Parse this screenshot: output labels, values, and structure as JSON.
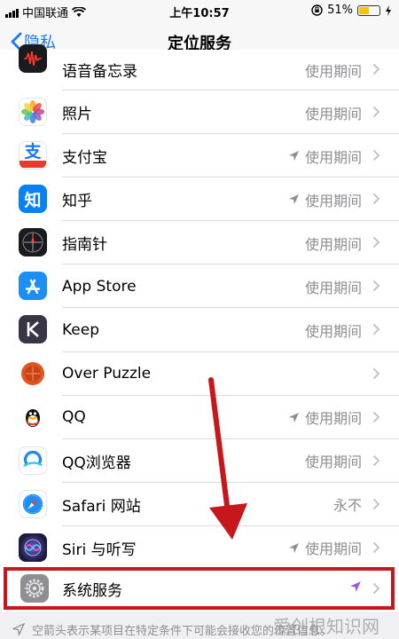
{
  "status_bar": {
    "carrier": "中国联通",
    "time": "上午10:57",
    "battery_percent": "51%",
    "battery_level": 0.51
  },
  "nav": {
    "back_label": "隐私",
    "title": "定位服务"
  },
  "rows": [
    {
      "label": "语音备忘录",
      "value": "使用期间",
      "arrow": false,
      "icon": "voice-memos-icon"
    },
    {
      "label": "照片",
      "value": "使用期间",
      "arrow": false,
      "icon": "photos-icon"
    },
    {
      "label": "支付宝",
      "value": "使用期间",
      "arrow": true,
      "icon": "alipay-icon"
    },
    {
      "label": "知乎",
      "value": "使用期间",
      "arrow": true,
      "icon": "zhihu-icon"
    },
    {
      "label": "指南针",
      "value": "使用期间",
      "arrow": false,
      "icon": "compass-icon"
    },
    {
      "label": "App Store",
      "value": "使用期间",
      "arrow": false,
      "icon": "app-store-icon"
    },
    {
      "label": "Keep",
      "value": "使用期间",
      "arrow": false,
      "icon": "keep-icon"
    },
    {
      "label": "Over Puzzle",
      "value": "",
      "arrow": false,
      "icon": "over-puzzle-icon"
    },
    {
      "label": "QQ",
      "value": "使用期间",
      "arrow": true,
      "icon": "qq-icon"
    },
    {
      "label": "QQ浏览器",
      "value": "使用期间",
      "arrow": false,
      "icon": "qq-browser-icon"
    },
    {
      "label": "Safari 网站",
      "value": "永不",
      "arrow": false,
      "icon": "safari-icon"
    },
    {
      "label": "Siri 与听写",
      "value": "使用期间",
      "arrow": true,
      "icon": "siri-icon"
    }
  ],
  "system_services": {
    "label": "系统服务",
    "icon": "settings-gear-icon",
    "arrow_color": "#9b59d6"
  },
  "footer": {
    "note": "空箭头表示某项目在特定条件下可能会接收您的位置信息。"
  },
  "watermark": "爱创根知识网",
  "colors": {
    "accent": "#1a7cf5",
    "annotation_red": "#c8161d"
  }
}
